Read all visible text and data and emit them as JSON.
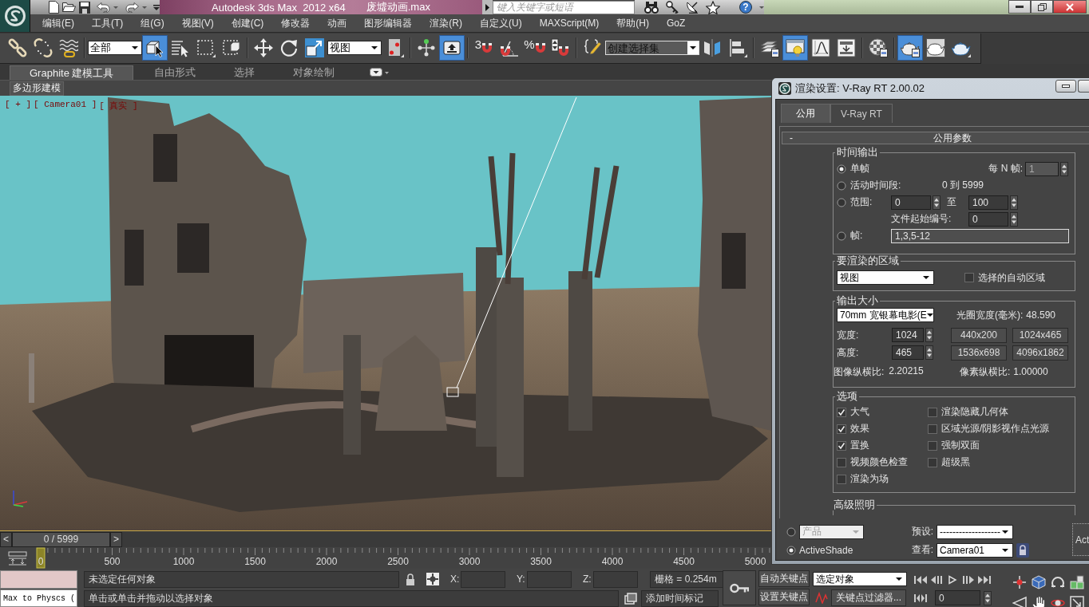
{
  "title_bar": {
    "app_title": "Autodesk 3ds Max  2012 x64",
    "file_name": "废墟动画.max",
    "search": {
      "placeholder": "键入关键字或短语"
    },
    "help": "?"
  },
  "menu_bar": [
    "编辑(E)",
    "工具(T)",
    "组(G)",
    "视图(V)",
    "创建(C)",
    "修改器",
    "动画",
    "图形编辑器",
    "渲染(R)",
    "自定义(U)",
    "MAXScript(M)",
    "帮助(H)",
    "GoZ"
  ],
  "main_toolbar": {
    "groups": [
      [
        {
          "kind": "link",
          "on": false
        },
        {
          "kind": "unlink",
          "on": false
        },
        {
          "kind": "bind",
          "on": false
        }
      ],
      [
        {
          "kind": "dropdown",
          "value": "全部"
        },
        {
          "kind": "select",
          "on": true
        },
        {
          "kind": "selectbyname",
          "on": false
        },
        {
          "kind": "region",
          "on": false
        },
        {
          "kind": "crossing",
          "on": false
        }
      ],
      [
        {
          "kind": "move",
          "on": false
        },
        {
          "kind": "rotate",
          "on": false
        },
        {
          "kind": "scale",
          "on": false
        },
        {
          "kind": "dropdown",
          "value": "视图"
        },
        {
          "kind": "pivot",
          "on": false
        }
      ],
      [
        {
          "kind": "manipulate",
          "on": false
        },
        {
          "kind": "shortcut",
          "on": true
        }
      ],
      [
        {
          "kind": "snap",
          "label": "3",
          "on": false
        },
        {
          "kind": "anglesnap",
          "on": false
        },
        {
          "kind": "percentsnap",
          "label": "%",
          "on": false
        },
        {
          "kind": "spinnersnap",
          "on": false
        }
      ],
      [
        {
          "kind": "namedsets",
          "on": false
        },
        {
          "kind": "combo",
          "placeholder": "创建选择集"
        },
        {
          "kind": "mirror",
          "on": false
        },
        {
          "kind": "align",
          "on": false
        }
      ],
      [
        {
          "kind": "layers",
          "on": false
        },
        {
          "kind": "graphite",
          "on": true
        },
        {
          "kind": "curves",
          "on": false
        },
        {
          "kind": "schematic",
          "on": false
        }
      ],
      [
        {
          "kind": "material",
          "on": false
        }
      ],
      [
        {
          "kind": "rendersetup",
          "on": true
        },
        {
          "kind": "framewindow",
          "on": false
        },
        {
          "kind": "render",
          "on": false
        }
      ]
    ]
  },
  "ribbon": {
    "tabs": [
      {
        "label": "Graphite 建模工具",
        "selected": true
      },
      {
        "label": "自由形式",
        "selected": false
      },
      {
        "label": "选择",
        "selected": false
      },
      {
        "label": "对象绘制",
        "selected": false
      }
    ],
    "panel_tab": "多边形建模"
  },
  "viewport": {
    "labels": [
      "[ + ]",
      "[ Camera01 ]",
      "[ 真实 ]"
    ]
  },
  "render_dialog": {
    "title": "渲染设置: V-Ray RT 2.00.02",
    "tabs": [
      {
        "label": "公用",
        "selected": true
      },
      {
        "label": "V-Ray RT",
        "selected": false
      }
    ],
    "rollout": {
      "toggle": "-",
      "title": "公用参数"
    },
    "time_output": {
      "title": "时间输出",
      "single": {
        "label": "单帧",
        "selected": true
      },
      "every_nth": {
        "label": "每 N 帧:",
        "value": "1",
        "disabled": true
      },
      "active_segment": {
        "label": "活动时间段:",
        "selected": false,
        "value": "0 到 5999"
      },
      "range": {
        "label": "范围:",
        "selected": false,
        "start": "0",
        "to": "至",
        "end": "100"
      },
      "file_number_base": {
        "label": "文件起始编号:",
        "value": "0"
      },
      "frames": {
        "label": "帧:",
        "selected": false,
        "value": "1,3,5-12"
      }
    },
    "area_to_render": {
      "title": "要渲染的区域",
      "dropdown": "视图",
      "auto_region": {
        "label": "选择的自动区域",
        "checked": false
      }
    },
    "output_size": {
      "title": "输出大小",
      "format": "70mm 宽银幕电影(E",
      "aperture": {
        "label": "光圈宽度(毫米):",
        "value": "48.590"
      },
      "width": {
        "label": "宽度:",
        "value": "1024"
      },
      "height": {
        "label": "高度:",
        "value": "465"
      },
      "presets": [
        "440x200",
        "1024x465",
        "1536x698",
        "4096x1862"
      ],
      "image_aspect": {
        "label": "图像纵横比:",
        "value": "2.20215"
      },
      "pixel_aspect": {
        "label": "像素纵横比:",
        "value": "1.00000"
      }
    },
    "options": {
      "title": "选项",
      "columns": [
        [
          {
            "label": "大气",
            "checked": true
          },
          {
            "label": "效果",
            "checked": true
          },
          {
            "label": "置换",
            "checked": true
          },
          {
            "label": "视频颜色检查",
            "checked": false
          },
          {
            "label": "渲染为场",
            "checked": false
          }
        ],
        [
          {
            "label": "渲染隐藏几何体",
            "checked": false
          },
          {
            "label": "区域光源/阴影视作点光源",
            "checked": false
          },
          {
            "label": "强制双面",
            "checked": false
          },
          {
            "label": "超级黑",
            "checked": false
          }
        ]
      ]
    },
    "advanced_lighting": {
      "title": "高级照明"
    },
    "footer": {
      "modes": [
        {
          "kind": "dropdown",
          "value": "产品",
          "selected": false
        },
        {
          "kind": "label",
          "label": "ActiveShade",
          "selected": true
        }
      ],
      "preset": {
        "label": "预设:",
        "value": "-------------------"
      },
      "view": {
        "label": "查看:",
        "value": "Camera01"
      },
      "render_button": "Act"
    }
  },
  "time_slider": {
    "prev": "<",
    "position": "0 / 5999",
    "next": ">",
    "level": 0
  },
  "track_bar": {
    "labels": [
      "0",
      "500",
      "1000",
      "1500",
      "2000",
      "2500",
      "3000",
      "3500",
      "4000",
      "4500",
      "5000"
    ]
  },
  "status_bar": {
    "listener": "Max to Physcs (",
    "selection": "未选定任何对象",
    "prompt": "单击或单击并拖动以选择对象",
    "coords": [
      "X:",
      "Y:",
      "Z:"
    ],
    "grid": "栅格 = 0.254m",
    "time_tag": "添加时间标记"
  },
  "key_controls": {
    "auto_key": "自动关键点",
    "set_key": "设置关键点",
    "key_set": "选定对象",
    "key_filters": "关键点过滤器...",
    "frame": "0"
  }
}
